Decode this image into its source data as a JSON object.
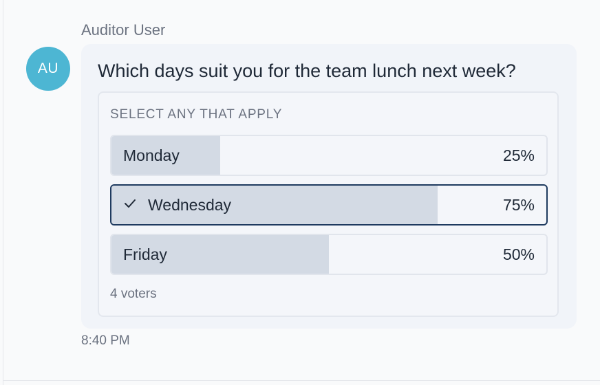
{
  "message": {
    "sender_name": "Auditor User",
    "avatar_initials": "AU",
    "avatar_color": "#4db6d3",
    "timestamp": "8:40 PM"
  },
  "poll": {
    "question": "Which days suit you for the team lunch next week?",
    "hint": "SELECT ANY THAT APPLY",
    "voters_label": "4 voters",
    "options": [
      {
        "label": "Monday",
        "percent_label": "25%",
        "percent": 25,
        "selected": false
      },
      {
        "label": "Wednesday",
        "percent_label": "75%",
        "percent": 75,
        "selected": true,
        "check_icon": "check-icon"
      },
      {
        "label": "Friday",
        "percent_label": "50%",
        "percent": 50,
        "selected": false
      }
    ]
  },
  "colors": {
    "selected_border": "#1e3a5f",
    "bar_fill": "#d3dae4"
  }
}
